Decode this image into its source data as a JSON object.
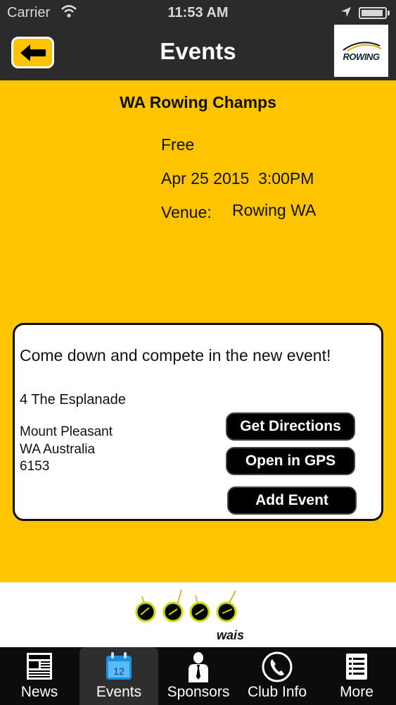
{
  "status_bar": {
    "carrier": "Carrier",
    "time": "11:53 AM"
  },
  "header": {
    "title": "Events",
    "logo_text": "ROWING"
  },
  "event": {
    "title": "WA Rowing Champs",
    "price": "Free",
    "datetime": "Apr 25 2015  3:00PM",
    "venue_label": "Venue:",
    "venue": "Rowing WA"
  },
  "details": {
    "description": "Come down and compete in the new event!",
    "address_line1": "4 The Esplanade",
    "suburb": "Mount Pleasant",
    "state_country": "WA Australia",
    "postcode": "6153",
    "buttons": {
      "directions": "Get Directions",
      "gps": "Open in GPS",
      "add": "Add Event"
    }
  },
  "sponsor": {
    "brand_text": "wais"
  },
  "tabs": [
    {
      "label": "News",
      "icon": "newspaper-icon"
    },
    {
      "label": "Events",
      "icon": "calendar-icon",
      "day": "12",
      "active": true
    },
    {
      "label": "Sponsors",
      "icon": "person-icon"
    },
    {
      "label": "Club Info",
      "icon": "phone-icon"
    },
    {
      "label": "More",
      "icon": "list-icon"
    }
  ],
  "colors": {
    "accent": "#ffc400",
    "bar": "#2b2b2b",
    "tabbar": "#0c0c0c"
  }
}
